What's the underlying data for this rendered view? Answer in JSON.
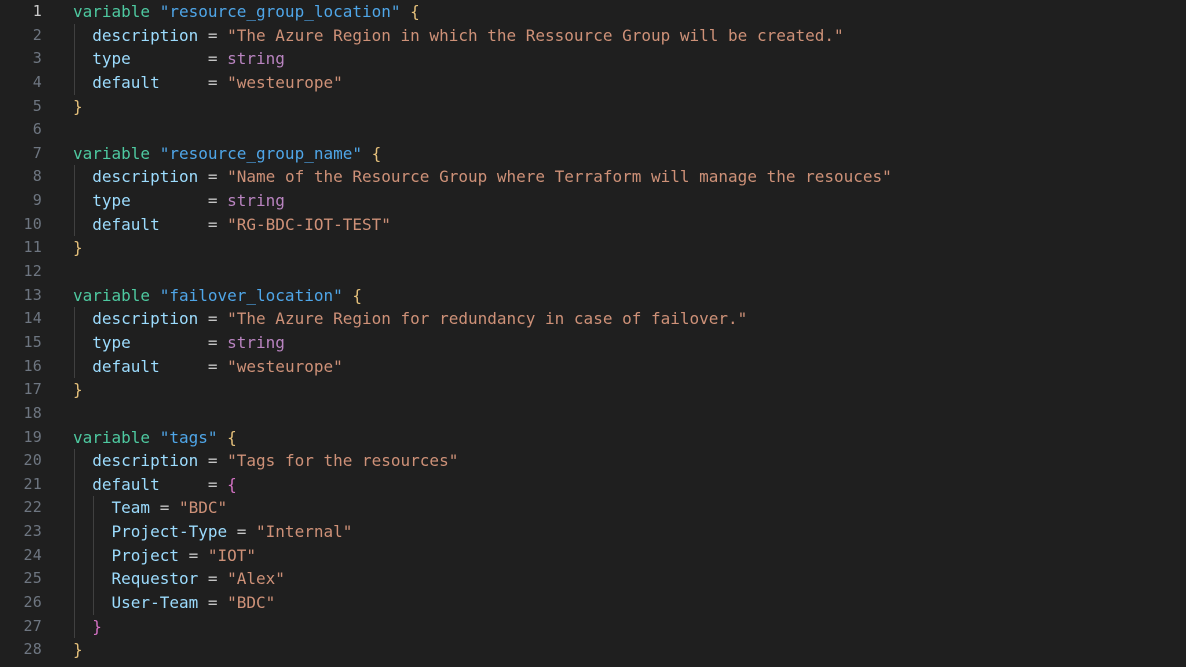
{
  "editor": {
    "kind": "code-editor",
    "language": "terraform",
    "background": "#1f1f1f",
    "line_number_color": "#6e7681",
    "active_line_number_color": "#cccccc",
    "indent_guide_color": "#404040",
    "font_size_px": 16,
    "line_height_px": 23.65,
    "total_lines_visible": 28,
    "colors": {
      "keyword": "#4ec9a0",
      "block_label": "#4fa6e8",
      "property": "#9cdcfe",
      "operator": "#c5c5c5",
      "string": "#ce9178",
      "type": "#b984c0",
      "bracket_level_1": "#e5c07b",
      "bracket_level_2": "#d371c3"
    },
    "lines": [
      {
        "num": "1",
        "indent": 0,
        "tokens": [
          {
            "text": "variable ",
            "cls": "t-kw"
          },
          {
            "text": "\"resource_group_location\"",
            "cls": "t-name"
          },
          {
            "text": " ",
            "cls": "t-plain"
          },
          {
            "text": "{",
            "cls": "t-br1"
          }
        ]
      },
      {
        "num": "2",
        "indent": 1,
        "tokens": [
          {
            "text": "  ",
            "cls": "t-plain"
          },
          {
            "text": "description",
            "cls": "t-prop"
          },
          {
            "text": " = ",
            "cls": "t-op"
          },
          {
            "text": "\"The Azure Region in which the Ressource Group will be created.\"",
            "cls": "t-str"
          }
        ]
      },
      {
        "num": "3",
        "indent": 1,
        "tokens": [
          {
            "text": "  ",
            "cls": "t-plain"
          },
          {
            "text": "type",
            "cls": "t-prop"
          },
          {
            "text": "        = ",
            "cls": "t-op"
          },
          {
            "text": "string",
            "cls": "t-type"
          }
        ]
      },
      {
        "num": "4",
        "indent": 1,
        "tokens": [
          {
            "text": "  ",
            "cls": "t-plain"
          },
          {
            "text": "default",
            "cls": "t-prop"
          },
          {
            "text": "     = ",
            "cls": "t-op"
          },
          {
            "text": "\"westeurope\"",
            "cls": "t-str"
          }
        ]
      },
      {
        "num": "5",
        "indent": 0,
        "tokens": [
          {
            "text": "}",
            "cls": "t-br1"
          }
        ]
      },
      {
        "num": "6",
        "indent": 0,
        "tokens": []
      },
      {
        "num": "7",
        "indent": 0,
        "tokens": [
          {
            "text": "variable ",
            "cls": "t-kw"
          },
          {
            "text": "\"resource_group_name\"",
            "cls": "t-name"
          },
          {
            "text": " ",
            "cls": "t-plain"
          },
          {
            "text": "{",
            "cls": "t-br1"
          }
        ]
      },
      {
        "num": "8",
        "indent": 1,
        "tokens": [
          {
            "text": "  ",
            "cls": "t-plain"
          },
          {
            "text": "description",
            "cls": "t-prop"
          },
          {
            "text": " = ",
            "cls": "t-op"
          },
          {
            "text": "\"Name of the Resource Group where Terraform will manage the resouces\"",
            "cls": "t-str"
          }
        ]
      },
      {
        "num": "9",
        "indent": 1,
        "tokens": [
          {
            "text": "  ",
            "cls": "t-plain"
          },
          {
            "text": "type",
            "cls": "t-prop"
          },
          {
            "text": "        = ",
            "cls": "t-op"
          },
          {
            "text": "string",
            "cls": "t-type"
          }
        ]
      },
      {
        "num": "10",
        "indent": 1,
        "tokens": [
          {
            "text": "  ",
            "cls": "t-plain"
          },
          {
            "text": "default",
            "cls": "t-prop"
          },
          {
            "text": "     = ",
            "cls": "t-op"
          },
          {
            "text": "\"RG-BDC-IOT-TEST\"",
            "cls": "t-str"
          }
        ]
      },
      {
        "num": "11",
        "indent": 0,
        "tokens": [
          {
            "text": "}",
            "cls": "t-br1"
          }
        ]
      },
      {
        "num": "12",
        "indent": 0,
        "tokens": []
      },
      {
        "num": "13",
        "indent": 0,
        "tokens": [
          {
            "text": "variable ",
            "cls": "t-kw"
          },
          {
            "text": "\"failover_location\"",
            "cls": "t-name"
          },
          {
            "text": " ",
            "cls": "t-plain"
          },
          {
            "text": "{",
            "cls": "t-br1"
          }
        ]
      },
      {
        "num": "14",
        "indent": 1,
        "tokens": [
          {
            "text": "  ",
            "cls": "t-plain"
          },
          {
            "text": "description",
            "cls": "t-prop"
          },
          {
            "text": " = ",
            "cls": "t-op"
          },
          {
            "text": "\"The Azure Region for redundancy in case of failover.\"",
            "cls": "t-str"
          }
        ]
      },
      {
        "num": "15",
        "indent": 1,
        "tokens": [
          {
            "text": "  ",
            "cls": "t-plain"
          },
          {
            "text": "type",
            "cls": "t-prop"
          },
          {
            "text": "        = ",
            "cls": "t-op"
          },
          {
            "text": "string",
            "cls": "t-type"
          }
        ]
      },
      {
        "num": "16",
        "indent": 1,
        "tokens": [
          {
            "text": "  ",
            "cls": "t-plain"
          },
          {
            "text": "default",
            "cls": "t-prop"
          },
          {
            "text": "     = ",
            "cls": "t-op"
          },
          {
            "text": "\"westeurope\"",
            "cls": "t-str"
          }
        ]
      },
      {
        "num": "17",
        "indent": 0,
        "tokens": [
          {
            "text": "}",
            "cls": "t-br1"
          }
        ]
      },
      {
        "num": "18",
        "indent": 0,
        "tokens": []
      },
      {
        "num": "19",
        "indent": 0,
        "tokens": [
          {
            "text": "variable ",
            "cls": "t-kw"
          },
          {
            "text": "\"tags\"",
            "cls": "t-name"
          },
          {
            "text": " ",
            "cls": "t-plain"
          },
          {
            "text": "{",
            "cls": "t-br1"
          }
        ]
      },
      {
        "num": "20",
        "indent": 1,
        "tokens": [
          {
            "text": "  ",
            "cls": "t-plain"
          },
          {
            "text": "description",
            "cls": "t-prop"
          },
          {
            "text": " = ",
            "cls": "t-op"
          },
          {
            "text": "\"Tags for the resources\"",
            "cls": "t-str"
          }
        ]
      },
      {
        "num": "21",
        "indent": 1,
        "tokens": [
          {
            "text": "  ",
            "cls": "t-plain"
          },
          {
            "text": "default",
            "cls": "t-prop"
          },
          {
            "text": "     = ",
            "cls": "t-op"
          },
          {
            "text": "{",
            "cls": "t-br2"
          }
        ]
      },
      {
        "num": "22",
        "indent": 2,
        "tokens": [
          {
            "text": "    ",
            "cls": "t-plain"
          },
          {
            "text": "Team",
            "cls": "t-prop"
          },
          {
            "text": " = ",
            "cls": "t-op"
          },
          {
            "text": "\"BDC\"",
            "cls": "t-str"
          }
        ]
      },
      {
        "num": "23",
        "indent": 2,
        "tokens": [
          {
            "text": "    ",
            "cls": "t-plain"
          },
          {
            "text": "Project-Type",
            "cls": "t-prop"
          },
          {
            "text": " = ",
            "cls": "t-op"
          },
          {
            "text": "\"Internal\"",
            "cls": "t-str"
          }
        ]
      },
      {
        "num": "24",
        "indent": 2,
        "tokens": [
          {
            "text": "    ",
            "cls": "t-plain"
          },
          {
            "text": "Project",
            "cls": "t-prop"
          },
          {
            "text": " = ",
            "cls": "t-op"
          },
          {
            "text": "\"IOT\"",
            "cls": "t-str"
          }
        ]
      },
      {
        "num": "25",
        "indent": 2,
        "tokens": [
          {
            "text": "    ",
            "cls": "t-plain"
          },
          {
            "text": "Requestor",
            "cls": "t-prop"
          },
          {
            "text": " = ",
            "cls": "t-op"
          },
          {
            "text": "\"Alex\"",
            "cls": "t-str"
          }
        ]
      },
      {
        "num": "26",
        "indent": 2,
        "tokens": [
          {
            "text": "    ",
            "cls": "t-plain"
          },
          {
            "text": "User-Team",
            "cls": "t-prop"
          },
          {
            "text": " = ",
            "cls": "t-op"
          },
          {
            "text": "\"BDC\"",
            "cls": "t-str"
          }
        ]
      },
      {
        "num": "27",
        "indent": 1,
        "tokens": [
          {
            "text": "  ",
            "cls": "t-plain"
          },
          {
            "text": "}",
            "cls": "t-br2"
          }
        ]
      },
      {
        "num": "28",
        "indent": 0,
        "tokens": [
          {
            "text": "}",
            "cls": "t-br1"
          }
        ]
      }
    ]
  }
}
